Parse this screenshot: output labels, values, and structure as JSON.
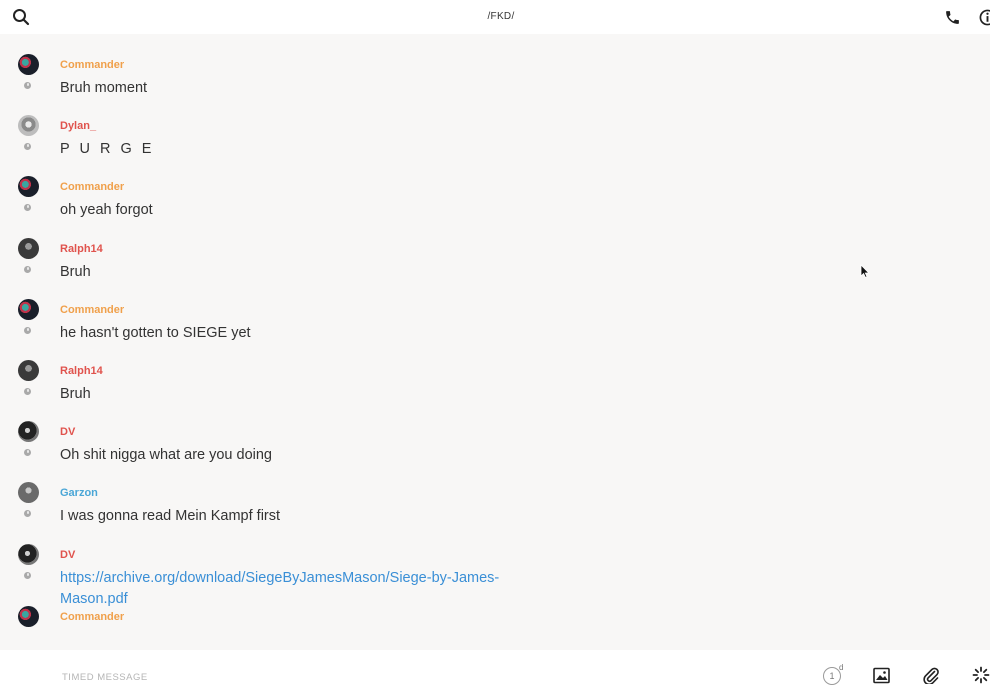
{
  "header": {
    "title": "/FKD/"
  },
  "messages": [
    {
      "author": "Commander",
      "text": "Bruh moment"
    },
    {
      "author": "Dylan_",
      "text": "P U R G E"
    },
    {
      "author": "Commander",
      "text": "oh yeah forgot"
    },
    {
      "author": "Ralph14",
      "text": "Bruh"
    },
    {
      "author": "Commander",
      "text": "he hasn't gotten to SIEGE yet"
    },
    {
      "author": "Ralph14",
      "text": "Bruh"
    },
    {
      "author": "DV",
      "text": "Oh shit nigga what are you doing"
    },
    {
      "author": "Garzon",
      "text": "I was gonna read Mein Kampf first"
    },
    {
      "author": "DV",
      "text": "https://archive.org/download/SiegeByJamesMason/Siege-by-James-Mason.pdf"
    },
    {
      "author": "Commander",
      "text": ""
    }
  ],
  "compose": {
    "placeholder": "TIMED MESSAGE",
    "timer_value": "1",
    "timer_unit": "d"
  },
  "colors": {
    "author_orange": "#f0a04b",
    "author_red": "#e0534d",
    "author_blue": "#4aa6d6",
    "link": "#3a8fd6"
  },
  "icons": {
    "top_left": "search-icon",
    "top_right": [
      "phone-icon",
      "info-icon"
    ],
    "compose": [
      "timer-icon",
      "image-icon",
      "paperclip-icon",
      "sticker-icon"
    ]
  }
}
